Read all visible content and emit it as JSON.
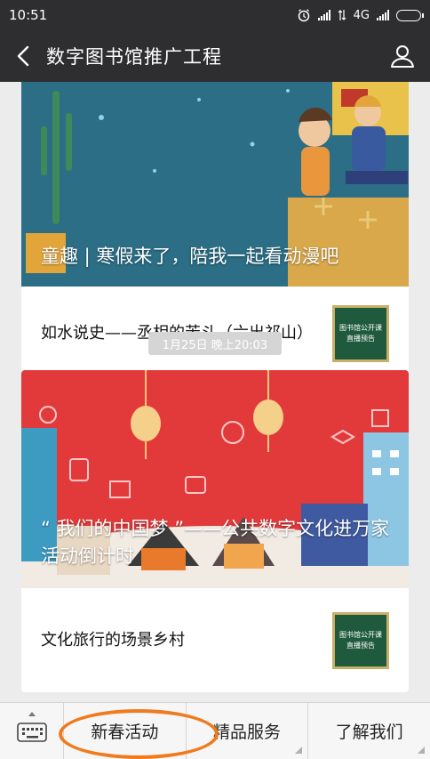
{
  "status_bar": {
    "time": "10:51",
    "network": "4G"
  },
  "header": {
    "title": "数字图书馆推广工程",
    "back_icon": "chevron-left-icon",
    "user_icon": "user-icon"
  },
  "articles": [
    {
      "banner_caption": "童趣 | 寒假来了，陪我一起看动漫吧",
      "sub_title": "如水说史——丞相的苦斗（六出祁山）",
      "thumb_text": [
        "图书馆公开课",
        "直播预告"
      ]
    },
    {
      "banner_caption": "“ 我们的中国梦 ”——公共数字文化进万家活动倒计时",
      "sub_title": "文化旅行的场景乡村",
      "thumb_text": [
        "图书馆公开课",
        "直播预告"
      ]
    }
  ],
  "timestamp": "1月25日 晚上20:03",
  "bottom_menu": [
    {
      "label": "新春活动",
      "has_submenu": false
    },
    {
      "label": "精品服务",
      "has_submenu": true
    },
    {
      "label": "了解我们",
      "has_submenu": true
    }
  ],
  "colors": {
    "nav_bg": "#2e2e30",
    "highlight_oval": "#f07b1e"
  }
}
